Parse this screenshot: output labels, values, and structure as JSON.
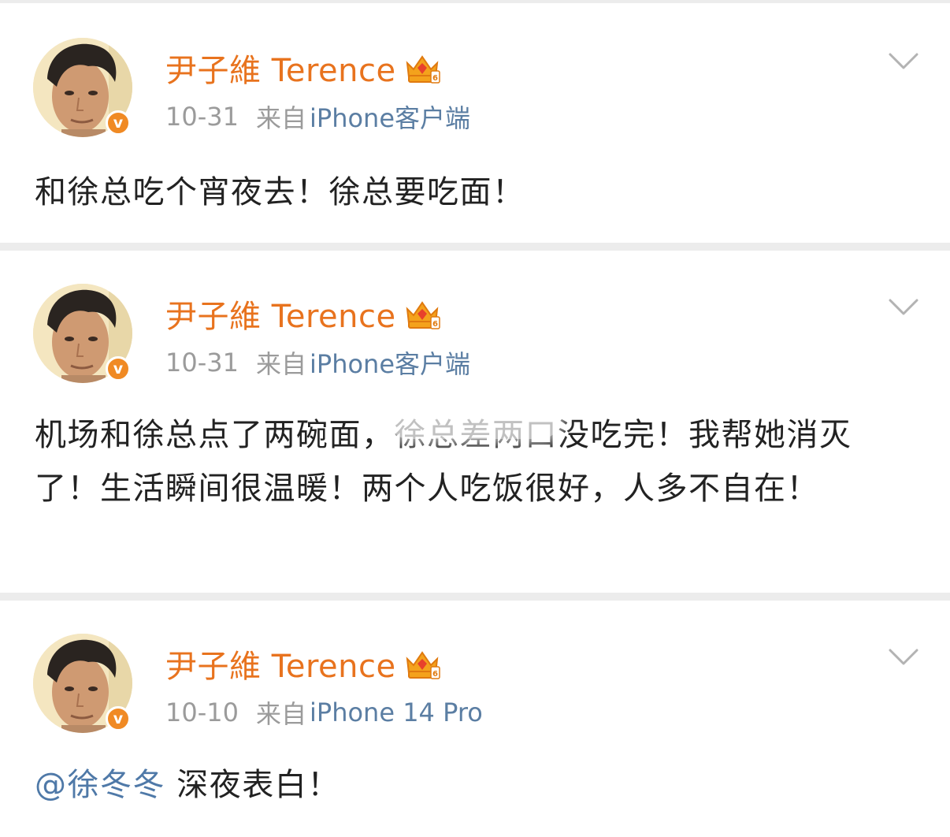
{
  "posts": [
    {
      "author": "尹子維 Terence",
      "date": "10-31",
      "from_label": "来自",
      "device": "iPhone客户端",
      "text": "和徐总吃个宵夜去！徐总要吃面！",
      "verified_label": "v"
    },
    {
      "author": "尹子維 Terence",
      "date": "10-31",
      "from_label": "来自",
      "device": "iPhone客户端",
      "text": "机场和徐总点了两碗面，徐总差两口没吃完！我帮她消灭了！生活瞬间很温暖！两个人吃饭很好，人多不自在！",
      "verified_label": "v"
    },
    {
      "author": "尹子維 Terence",
      "date": "10-10",
      "from_label": "来自",
      "device": "iPhone 14 Pro",
      "mention": "@徐冬冬",
      "text": " 深夜表白！",
      "verified_label": "v"
    }
  ],
  "icons": {
    "crown": "crown-badge-icon",
    "menu": "chevron-down-icon",
    "verified": "verified-badge-icon"
  },
  "colors": {
    "author_name": "#e8731e",
    "device_link": "#5b7ea3",
    "mention": "#4f79a8",
    "meta_gray": "#9b9b9b",
    "verified_badge": "#f08a24",
    "feed_background": "#ececec"
  }
}
